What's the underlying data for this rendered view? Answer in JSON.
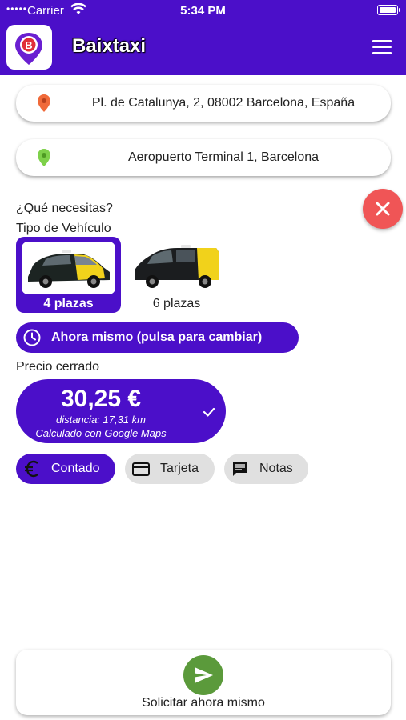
{
  "status_bar": {
    "dots": "•••••",
    "carrier": "Carrier",
    "time": "5:34 PM"
  },
  "header": {
    "title": "Baixtaxi",
    "brand_color": "#4b0fc9"
  },
  "route": {
    "origin": "Pl. de Catalunya, 2, 08002 Barcelona, España",
    "destination": "Aeropuerto Terminal 1, Barcelona",
    "origin_pin_color": "#f06a3a",
    "destination_pin_color": "#7ed14a"
  },
  "form": {
    "question": "¿Qué necesitas?",
    "vehicle_type_label": "Tipo de Vehículo",
    "vehicles": [
      {
        "label": "4 plazas",
        "selected": true
      },
      {
        "label": "6 plazas",
        "selected": false
      }
    ],
    "time_option": "Ahora mismo (pulsa para cambiar)",
    "price_label": "Precio cerrado"
  },
  "price": {
    "amount": "30,25 €",
    "distance": "distancia: 17,31 km",
    "source": "Calculado con Google Maps"
  },
  "payment": {
    "options": [
      {
        "label": "Contado",
        "icon": "euro-icon",
        "selected": true
      },
      {
        "label": "Tarjeta",
        "icon": "credit-card-icon",
        "selected": false
      },
      {
        "label": "Notas",
        "icon": "notes-icon",
        "selected": false
      }
    ]
  },
  "actions": {
    "request_label": "Solicitar ahora mismo",
    "close_color": "#f05556",
    "send_color": "#5b9a3b"
  }
}
